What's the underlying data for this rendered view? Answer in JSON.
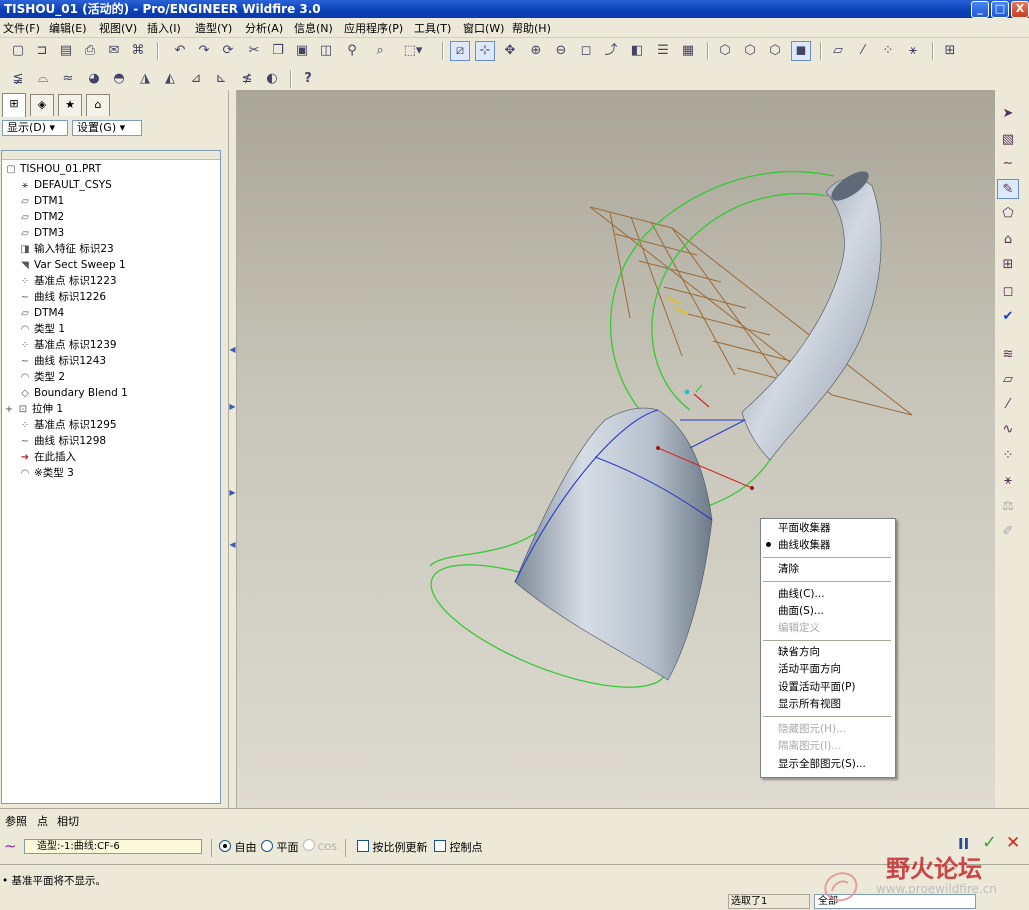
{
  "window": {
    "title": "TISHOU_01 (活动的) - Pro/ENGINEER Wildfire 3.0",
    "controls": [
      "_",
      "□",
      "X"
    ]
  },
  "menubar": [
    "文件(F)",
    "编辑(E)",
    "视图(V)",
    "插入(I)",
    "造型(Y)",
    "分析(A)",
    "信息(N)",
    "应用程序(P)",
    "工具(T)",
    "窗口(W)",
    "帮助(H)"
  ],
  "toolbar_help_glyph": "?",
  "left_panel": {
    "tabs": [
      "model-tree",
      "layers",
      "favorites",
      "connections"
    ],
    "show_dropdown": "显示(D) ▾",
    "settings_dropdown": "设置(G) ▾",
    "tree": [
      {
        "label": "TISHOU_01.PRT",
        "icon": "part-icon",
        "indent": 0
      },
      {
        "label": "DEFAULT_CSYS",
        "icon": "csys-icon",
        "indent": 1
      },
      {
        "label": "DTM1",
        "icon": "datum-plane-icon",
        "indent": 1
      },
      {
        "label": "DTM2",
        "icon": "datum-plane-icon",
        "indent": 1
      },
      {
        "label": "DTM3",
        "icon": "datum-plane-icon",
        "indent": 1
      },
      {
        "label": "输入特征 标识23",
        "icon": "import-feature-icon",
        "indent": 1
      },
      {
        "label": "Var Sect Sweep 1",
        "icon": "sweep-icon",
        "indent": 1
      },
      {
        "label": "基准点 标识1223",
        "icon": "datum-point-icon",
        "indent": 1
      },
      {
        "label": "曲线 标识1226",
        "icon": "curve-icon",
        "indent": 1
      },
      {
        "label": "DTM4",
        "icon": "datum-plane-icon",
        "indent": 1
      },
      {
        "label": "类型 1",
        "icon": "style-icon",
        "indent": 1
      },
      {
        "label": "基准点 标识1239",
        "icon": "datum-point-icon",
        "indent": 1
      },
      {
        "label": "曲线 标识1243",
        "icon": "curve-icon",
        "indent": 1
      },
      {
        "label": "类型 2",
        "icon": "style-icon",
        "indent": 1
      },
      {
        "label": "Boundary Blend 1",
        "icon": "boundary-blend-icon",
        "indent": 1
      },
      {
        "label": "拉伸 1",
        "icon": "extrude-icon",
        "indent": 1,
        "expand": "+"
      },
      {
        "label": "基准点 标识1295",
        "icon": "datum-point-icon",
        "indent": 1
      },
      {
        "label": "曲线 标识1298",
        "icon": "curve-icon",
        "indent": 1
      },
      {
        "label": "在此插入",
        "icon": "insert-here-arrow-icon",
        "indent": 1
      },
      {
        "label": "※类型 3",
        "icon": "style-icon",
        "indent": 1
      }
    ]
  },
  "context_menu": {
    "items": [
      {
        "label": "平面收集器",
        "enabled": true
      },
      {
        "label": "曲线收集器",
        "enabled": true,
        "selected": true
      },
      {
        "separator": true
      },
      {
        "label": "清除",
        "enabled": true
      },
      {
        "separator": true
      },
      {
        "label": "曲线(C)...",
        "enabled": true
      },
      {
        "label": "曲面(S)...",
        "enabled": true
      },
      {
        "label": "编辑定义",
        "enabled": false
      },
      {
        "separator": true
      },
      {
        "label": "缺省方向",
        "enabled": true
      },
      {
        "label": "活动平面方向",
        "enabled": true
      },
      {
        "label": "设置活动平面(P)",
        "enabled": true
      },
      {
        "label": "显示所有视图",
        "enabled": true
      },
      {
        "separator": true
      },
      {
        "label": "隐藏图元(H)...",
        "enabled": false
      },
      {
        "label": "隔离图元(I)...",
        "enabled": false
      },
      {
        "label": "显示全部图元(S)...",
        "enabled": true
      }
    ]
  },
  "dashboard": {
    "tabs": [
      "参照",
      "点",
      "相切"
    ],
    "curve_field": "造型:-1:曲线:CF-6",
    "radio_options": [
      {
        "label": "自由",
        "selected": true,
        "enabled": true
      },
      {
        "label": "平面",
        "selected": false,
        "enabled": true
      },
      {
        "label": "COS",
        "selected": false,
        "enabled": false
      }
    ],
    "checkboxes": [
      {
        "label": "按比例更新",
        "checked": false
      },
      {
        "label": "控制点",
        "checked": false
      }
    ],
    "pause_glyph": "II",
    "ok_glyph": "✓",
    "cancel_glyph": "✕"
  },
  "status": {
    "message": "• 基准平面将不显示。",
    "selection_count": "选取了1",
    "filter": "全部"
  },
  "watermark": {
    "text": "野火论坛",
    "url": "www.proewildfire.cn"
  },
  "colors": {
    "title_bar": "#0a3fb8",
    "viewport_top": "#a9a698",
    "viewport_bottom": "#dedbd0",
    "green_curve": "#38c838",
    "blue_curve": "#2a3ccc",
    "datum_plane": "#9a6a3a",
    "red_curve": "#d02a2a",
    "watermark": "#c8282d"
  }
}
